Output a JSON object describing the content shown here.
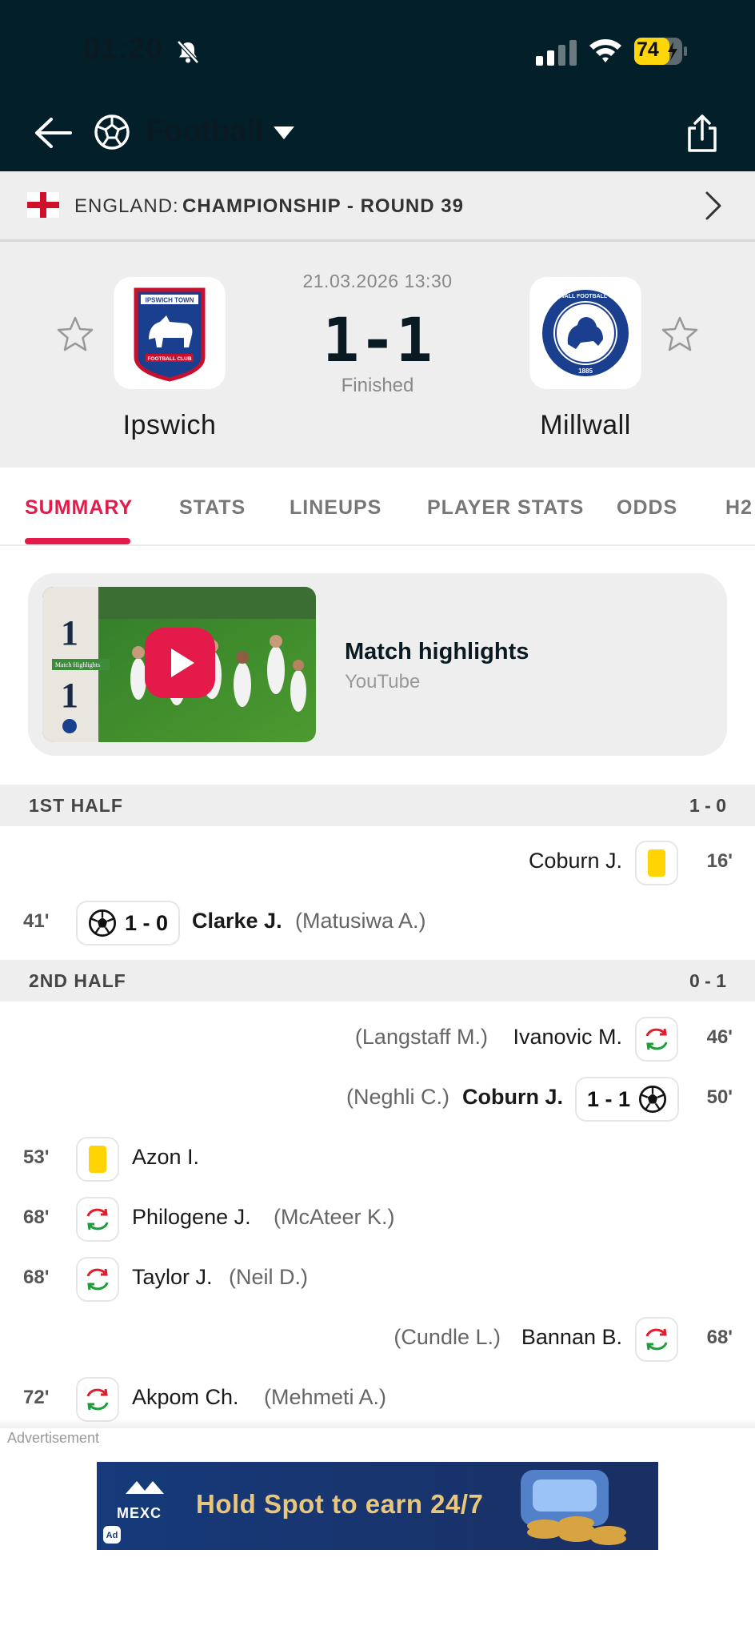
{
  "status_bar": {
    "time": "01:20",
    "battery": "74"
  },
  "nav": {
    "sport": "Football"
  },
  "competition": {
    "country": "ENGLAND:",
    "name": "CHAMPIONSHIP - ROUND 39"
  },
  "match": {
    "datetime": "21.03.2026 13:30",
    "score": "1-1",
    "status": "Finished",
    "home": {
      "name": "Ipswich",
      "crest_text": "IPSWICH TOWN",
      "crest_bottom": "FOOTBALL CLUB"
    },
    "away": {
      "name": "Millwall",
      "crest_text": "MILLWALL FOOTBALL CLUB",
      "crest_year": "1885"
    }
  },
  "tabs": [
    "SUMMARY",
    "STATS",
    "LINEUPS",
    "PLAYER STATS",
    "ODDS",
    "H2"
  ],
  "highlights": {
    "title": "Match highlights",
    "source": "YouTube",
    "thumb_label": "Match Highlights",
    "thumb_home": "1",
    "thumb_away": "1"
  },
  "periods": [
    {
      "label": "1ST HALF",
      "score": "1 - 0"
    },
    {
      "label": "2ND HALF",
      "score": "0 - 1"
    }
  ],
  "incidents": [
    {
      "minute": "16'",
      "side": "away",
      "type": "yellow-card",
      "player": "Coburn J.",
      "assist": ""
    },
    {
      "minute": "41'",
      "side": "home",
      "type": "goal",
      "score": "1 - 0",
      "player": "Clarke J.",
      "assist": "(Matusiwa A.)"
    },
    {
      "minute": "46'",
      "side": "away",
      "type": "substitution",
      "player": "Ivanovic M.",
      "assist": "(Langstaff M.)"
    },
    {
      "minute": "50'",
      "side": "away",
      "type": "goal",
      "score": "1 - 1",
      "player": "Coburn J.",
      "assist": "(Neghli C.)"
    },
    {
      "minute": "53'",
      "side": "home",
      "type": "yellow-card",
      "player": "Azon I.",
      "assist": ""
    },
    {
      "minute": "68'",
      "side": "home",
      "type": "substitution",
      "player": "Philogene J.",
      "assist": "(McAteer K.)"
    },
    {
      "minute": "68'",
      "side": "home",
      "type": "substitution",
      "player": "Taylor J.",
      "assist": "(Neil D.)"
    },
    {
      "minute": "68'",
      "side": "away",
      "type": "substitution",
      "player": "Bannan B.",
      "assist": "(Cundle L.)"
    },
    {
      "minute": "72'",
      "side": "home",
      "type": "substitution",
      "player": "Akpom Ch.",
      "assist": "(Mehmeti A.)"
    }
  ],
  "ad": {
    "label": "Advertisement",
    "headline": "Hold Spot to earn 24/7",
    "brand": "MEXC",
    "badge": "Ad"
  },
  "colors": {
    "accent": "#e41a4a",
    "header_bg": "#021f2a",
    "yellow_card": "#ffd400",
    "sub_in": "#1e9e3a",
    "sub_out": "#e01e2d"
  }
}
